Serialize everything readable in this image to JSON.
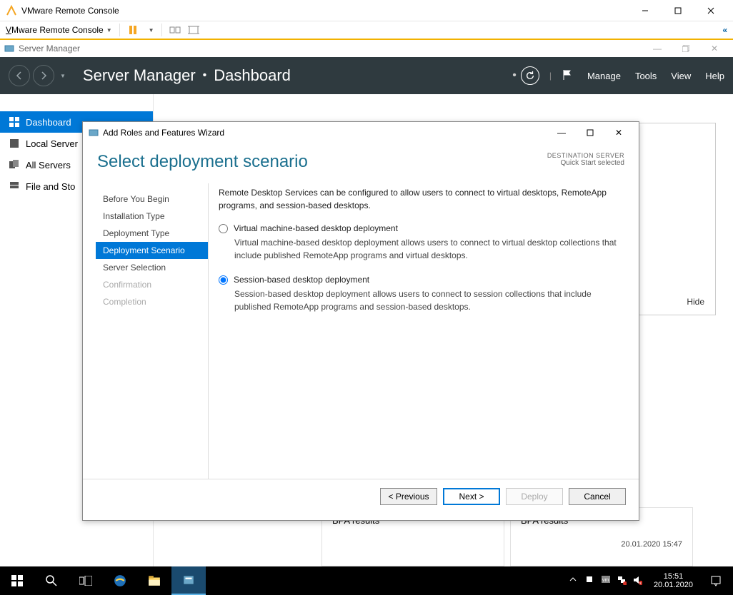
{
  "vmware": {
    "title": "VMware Remote Console",
    "menu": "Mware Remote Console",
    "menu_u": "V"
  },
  "server_manager": {
    "title": "Server Manager",
    "breadcrumb_root": "Server Manager",
    "breadcrumb_page": "Dashboard",
    "menus": [
      "Manage",
      "Tools",
      "View",
      "Help"
    ],
    "sidebar": [
      {
        "label": "Dashboard",
        "active": true
      },
      {
        "label": "Local Server",
        "active": false
      },
      {
        "label": "All Servers",
        "active": false
      },
      {
        "label": "File and Storage Services",
        "active": false
      }
    ],
    "hide": "Hide",
    "bpa": [
      {
        "label": "BPA results",
        "ts": ""
      },
      {
        "label": "BPA results",
        "ts": "20.01.2020 15:47"
      }
    ]
  },
  "wizard": {
    "title": "Add Roles and Features Wizard",
    "heading": "Select deployment scenario",
    "dest_label": "DESTINATION SERVER",
    "dest_value": "Quick Start selected",
    "steps": [
      {
        "label": "Before You Begin",
        "state": "normal"
      },
      {
        "label": "Installation Type",
        "state": "normal"
      },
      {
        "label": "Deployment Type",
        "state": "normal"
      },
      {
        "label": "Deployment Scenario",
        "state": "active"
      },
      {
        "label": "Server Selection",
        "state": "normal"
      },
      {
        "label": "Confirmation",
        "state": "disabled"
      },
      {
        "label": "Completion",
        "state": "disabled"
      }
    ],
    "intro": "Remote Desktop Services can be configured to allow users to connect to virtual desktops, RemoteApp programs, and session-based desktops.",
    "options": [
      {
        "label": "Virtual machine-based desktop deployment",
        "desc": "Virtual machine-based desktop deployment allows users to connect to virtual desktop collections that include published RemoteApp programs and virtual desktops.",
        "checked": false
      },
      {
        "label": "Session-based desktop deployment",
        "desc": "Session-based desktop deployment allows users to connect to session collections that include published RemoteApp programs and session-based desktops.",
        "checked": true
      }
    ],
    "buttons": {
      "previous": "< Previous",
      "next": "Next >",
      "deploy": "Deploy",
      "cancel": "Cancel"
    }
  },
  "taskbar": {
    "time": "15:51",
    "date": "20.01.2020"
  }
}
